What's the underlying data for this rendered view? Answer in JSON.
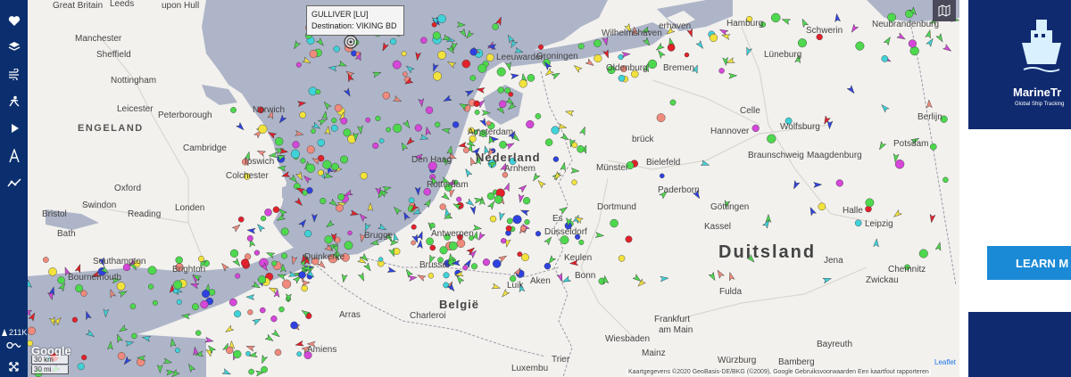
{
  "sidebar": {
    "items": [
      {
        "name": "favorites-heart-icon"
      },
      {
        "name": "layers-icon"
      },
      {
        "name": "weather-wind-icon"
      },
      {
        "name": "density-map-icon"
      },
      {
        "name": "play-track-icon"
      },
      {
        "name": "route-planner-icon"
      },
      {
        "name": "analytics-chart-icon"
      }
    ],
    "ship_count": "211K",
    "link_icon": "link-icon",
    "fullscreen_icon": "fullscreen-icon"
  },
  "tooltip": {
    "vessel": "GULLIVER [LU]",
    "destination": "Destination: VIKING BD"
  },
  "map": {
    "countries": [
      {
        "id": "duitsland",
        "text": "Duitsland"
      },
      {
        "id": "nederland",
        "text": "Nederland"
      },
      {
        "id": "belgie",
        "text": "België"
      }
    ],
    "regions": [
      {
        "id": "engeland",
        "text": "ENGELAND"
      }
    ],
    "cities": [
      {
        "id": "great-britain",
        "text": "Great Britain"
      },
      {
        "id": "leeds",
        "text": "Leeds"
      },
      {
        "id": "upon-hull",
        "text": "upon Hull"
      },
      {
        "id": "manchester",
        "text": "Manchester"
      },
      {
        "id": "sheffield",
        "text": "Sheffield"
      },
      {
        "id": "nottingham",
        "text": "Nottingham"
      },
      {
        "id": "leicester",
        "text": "Leicester"
      },
      {
        "id": "peterborough",
        "text": "Peterborough"
      },
      {
        "id": "norwich",
        "text": "Norwich"
      },
      {
        "id": "cambridge",
        "text": "Cambridge"
      },
      {
        "id": "ipswich",
        "text": "Ipswich"
      },
      {
        "id": "colchester",
        "text": "Colchester"
      },
      {
        "id": "oxford",
        "text": "Oxford"
      },
      {
        "id": "swindon",
        "text": "Swindon"
      },
      {
        "id": "bristol",
        "text": "Bristol"
      },
      {
        "id": "bath",
        "text": "Bath"
      },
      {
        "id": "reading",
        "text": "Reading"
      },
      {
        "id": "londen",
        "text": "Londen"
      },
      {
        "id": "southampton",
        "text": "Southampton"
      },
      {
        "id": "bournemouth",
        "text": "Bournemouth"
      },
      {
        "id": "brighton",
        "text": "Brighton"
      },
      {
        "id": "duinkerke",
        "text": "Duinkerke"
      },
      {
        "id": "brugge",
        "text": "Brugge"
      },
      {
        "id": "antwerpen",
        "text": "Antwerpen"
      },
      {
        "id": "brussel",
        "text": "Brussel"
      },
      {
        "id": "charleroi",
        "text": "Charleroi"
      },
      {
        "id": "arras",
        "text": "Arras"
      },
      {
        "id": "amiens",
        "text": "Amiens"
      },
      {
        "id": "luik",
        "text": "Luik"
      },
      {
        "id": "aken",
        "text": "Aken"
      },
      {
        "id": "den-haag",
        "text": "Den Haag"
      },
      {
        "id": "rotterdam",
        "text": "Rotterdam"
      },
      {
        "id": "amsterdam",
        "text": "Amsterdam"
      },
      {
        "id": "arnhem",
        "text": "Arnhem"
      },
      {
        "id": "groningen",
        "text": "Groningen"
      },
      {
        "id": "leeuwarden",
        "text": "Leeuwarden"
      },
      {
        "id": "wilhelmshaven",
        "text": "Wilhelmshaven"
      },
      {
        "id": "bremerhaven",
        "text": "erhaven"
      },
      {
        "id": "oldenburg",
        "text": "Oldenburg"
      },
      {
        "id": "bremen",
        "text": "Bremen"
      },
      {
        "id": "hamburg",
        "text": "Hamburg"
      },
      {
        "id": "schwerin",
        "text": "Schwerin"
      },
      {
        "id": "neubrandenburg",
        "text": "Neubrandenburg"
      },
      {
        "id": "luneburg",
        "text": "Lüneburg"
      },
      {
        "id": "celle",
        "text": "Celle"
      },
      {
        "id": "hannover",
        "text": "Hannover"
      },
      {
        "id": "wolfsburg",
        "text": "Wolfsburg"
      },
      {
        "id": "braunschweig",
        "text": "Braunschweig"
      },
      {
        "id": "magdeburg",
        "text": "Maagdenburg"
      },
      {
        "id": "berlijn",
        "text": "Berlijn"
      },
      {
        "id": "potsdam",
        "text": "Potsdam"
      },
      {
        "id": "osnabruck",
        "text": "brück"
      },
      {
        "id": "munster",
        "text": "Münster"
      },
      {
        "id": "bielefeld",
        "text": "Bielefeld"
      },
      {
        "id": "paderborn",
        "text": "Paderborn"
      },
      {
        "id": "dortmund",
        "text": "Dortmund"
      },
      {
        "id": "essen",
        "text": "Es"
      },
      {
        "id": "dusseldorf",
        "text": "Düsseldorf"
      },
      {
        "id": "keulen",
        "text": "Keulen"
      },
      {
        "id": "bonn",
        "text": "Bonn"
      },
      {
        "id": "gottingen",
        "text": "Göttingen"
      },
      {
        "id": "kassel",
        "text": "Kassel"
      },
      {
        "id": "halle",
        "text": "Halle"
      },
      {
        "id": "leipzig",
        "text": "Leipzig"
      },
      {
        "id": "jena",
        "text": "Jena"
      },
      {
        "id": "chemnitz",
        "text": "Chemnitz"
      },
      {
        "id": "zwickau",
        "text": "Zwickau"
      },
      {
        "id": "fulda",
        "text": "Fulda"
      },
      {
        "id": "frankfurt",
        "text": "Frankfurt"
      },
      {
        "id": "am-main",
        "text": "am Main"
      },
      {
        "id": "wiesbaden",
        "text": "Wiesbaden"
      },
      {
        "id": "mainz",
        "text": "Mainz"
      },
      {
        "id": "bayreuth",
        "text": "Bayreuth"
      },
      {
        "id": "wurzburg",
        "text": "Würzburg"
      },
      {
        "id": "bamberg",
        "text": "Bamberg"
      },
      {
        "id": "luxemburg",
        "text": "Luxembu"
      },
      {
        "id": "trier",
        "text": "Trier"
      }
    ],
    "scale": {
      "km": "30 km",
      "mi": "30 mi"
    },
    "google": "Google",
    "attribution": "Kaartgegevens ©2020 GeoBasis-DE/BKG (©2009), Google   Gebruiksvoorwaarden   Een kaartfout rapporteren",
    "leaflet": "Leaflet",
    "layer_icon": "map-layers-icon"
  },
  "ad": {
    "brand": "MarineTr",
    "tagline": "Global Ship Tracking",
    "cta": "LEARN M",
    "logo_icon": "ship-logo-icon"
  },
  "colors": {
    "sidebar": "#0b2f6e",
    "sea": "#aeb5c8",
    "land": "#f2f1ee",
    "cargo": "#4ed84e",
    "tanker": "#e3212b",
    "passenger": "#2f42e0",
    "pleasure": "#d447d8",
    "fishing": "#f08a7c",
    "tug": "#3fd2d8",
    "unknown": "#f2e23c",
    "ad_dark": "#102a70",
    "ad_cta": "#1a8ad6"
  }
}
